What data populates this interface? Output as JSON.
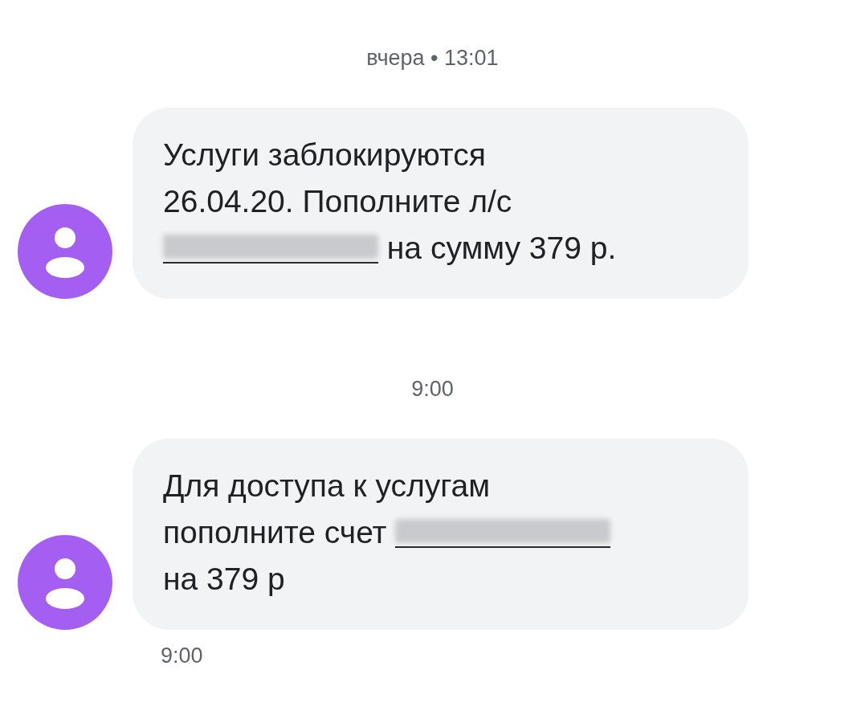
{
  "conversation": [
    {
      "kind": "divider",
      "text": "вчера • 13:01"
    },
    {
      "kind": "message",
      "lines": [
        [
          {
            "kind": "text",
            "text": "Услуги заблокируются"
          }
        ],
        [
          {
            "kind": "text",
            "text": "26.04.20. Пополните л/с"
          }
        ],
        [
          {
            "kind": "redacted"
          },
          {
            "kind": "text",
            "text": " на сумму 379 р."
          }
        ]
      ]
    },
    {
      "kind": "divider",
      "text": "9:00"
    },
    {
      "kind": "message",
      "lines": [
        [
          {
            "kind": "text",
            "text": "Для доступа к услугам"
          }
        ],
        [
          {
            "kind": "text",
            "text": "пополните счет "
          },
          {
            "kind": "redacted"
          }
        ],
        [
          {
            "kind": "text",
            "text": "на 379 р"
          }
        ]
      ],
      "time": "9:00"
    }
  ]
}
